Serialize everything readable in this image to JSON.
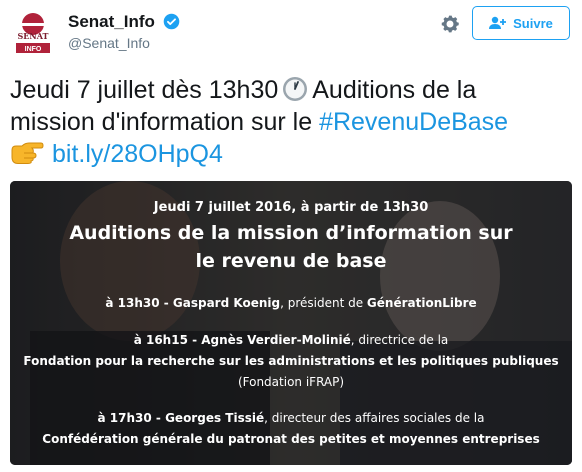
{
  "account": {
    "name": "Senat_Info",
    "handle": "@Senat_Info",
    "avatar_text_top": "SÉNAT",
    "avatar_text_bottom": "INFO"
  },
  "follow_label": "Suivre",
  "tweet": {
    "line1_before": "Jeudi 7 juillet dès 13h30",
    "line1_after": "Auditions de la",
    "line2_text": "mission d'information sur le ",
    "hashtag": "#RevenuDeBase",
    "link": "bit.ly/28OHpQ4"
  },
  "image": {
    "date_line": "Jeudi 7 juillet 2016, à partir de 13h30",
    "title_line1": "Auditions de la mission d’information sur",
    "title_line2": "le revenu de base",
    "s1_time": "à 13h30",
    "s1_sep": " - ",
    "s1_name": "Gaspard Koenig",
    "s1_role": ", président de ",
    "s1_org": "GénérationLibre",
    "s2_time": "à 16h15",
    "s2_sep": " - ",
    "s2_name": "Agnès Verdier-Molinié",
    "s2_role": ", directrice de la",
    "s2_org": "Fondation pour la recherche sur les administrations et les politiques publiques",
    "s2_org_short": "(Fondation iFRAP)",
    "s3_time": "à 17h30",
    "s3_sep": " - ",
    "s3_name": "Georges Tissié",
    "s3_role": ", directeur des affaires sociales de la",
    "s3_org": "Confédération générale du patronat des petites et moyennes entreprises"
  },
  "colors": {
    "link": "#1b95e0",
    "follow": "#1da1f2",
    "verified": "#1da1f2",
    "senat_red": "#b0223a"
  }
}
